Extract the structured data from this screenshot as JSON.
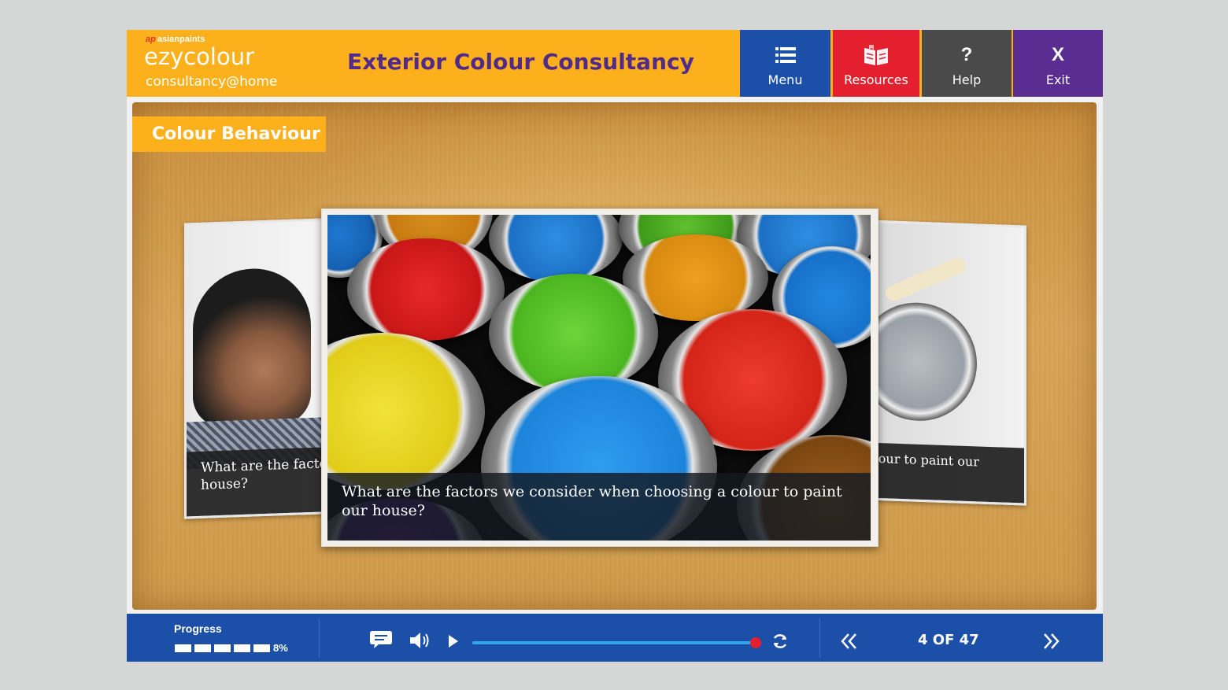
{
  "header": {
    "brand_small": "asianpaints",
    "logo_main": "ezycolour",
    "logo_sub": "consultancy@home",
    "course_title": "Exterior Colour Consultancy",
    "nav": {
      "menu": {
        "label": "Menu",
        "icon": "list-icon"
      },
      "resources": {
        "label": "Resources",
        "icon": "book-icon"
      },
      "help": {
        "label": "Help",
        "icon": "question-icon",
        "glyph": "?"
      },
      "exit": {
        "label": "Exit",
        "icon": "close-icon",
        "glyph": "X"
      }
    }
  },
  "slide": {
    "section_title": "Colour Behaviour",
    "left_card_caption_1": "What are the facto",
    "left_card_caption_2": "house?",
    "center_caption": "What are the factors we consider when choosing a colour to paint our house?",
    "right_card_caption": "olour to paint our"
  },
  "footer": {
    "progress_label": "Progress",
    "progress_percent_text": "8%",
    "progress_value": 0.08,
    "audio_position": 0.98,
    "page_indicator": "4 OF 47"
  },
  "colors": {
    "header_bg": "#fbb01c",
    "title": "#522a89",
    "menu_btn": "#1c4fa7",
    "resources_btn": "#e5202e",
    "help_btn": "#4a4a4a",
    "exit_btn": "#5a2d93",
    "footer_bg": "#1c4fa7"
  }
}
